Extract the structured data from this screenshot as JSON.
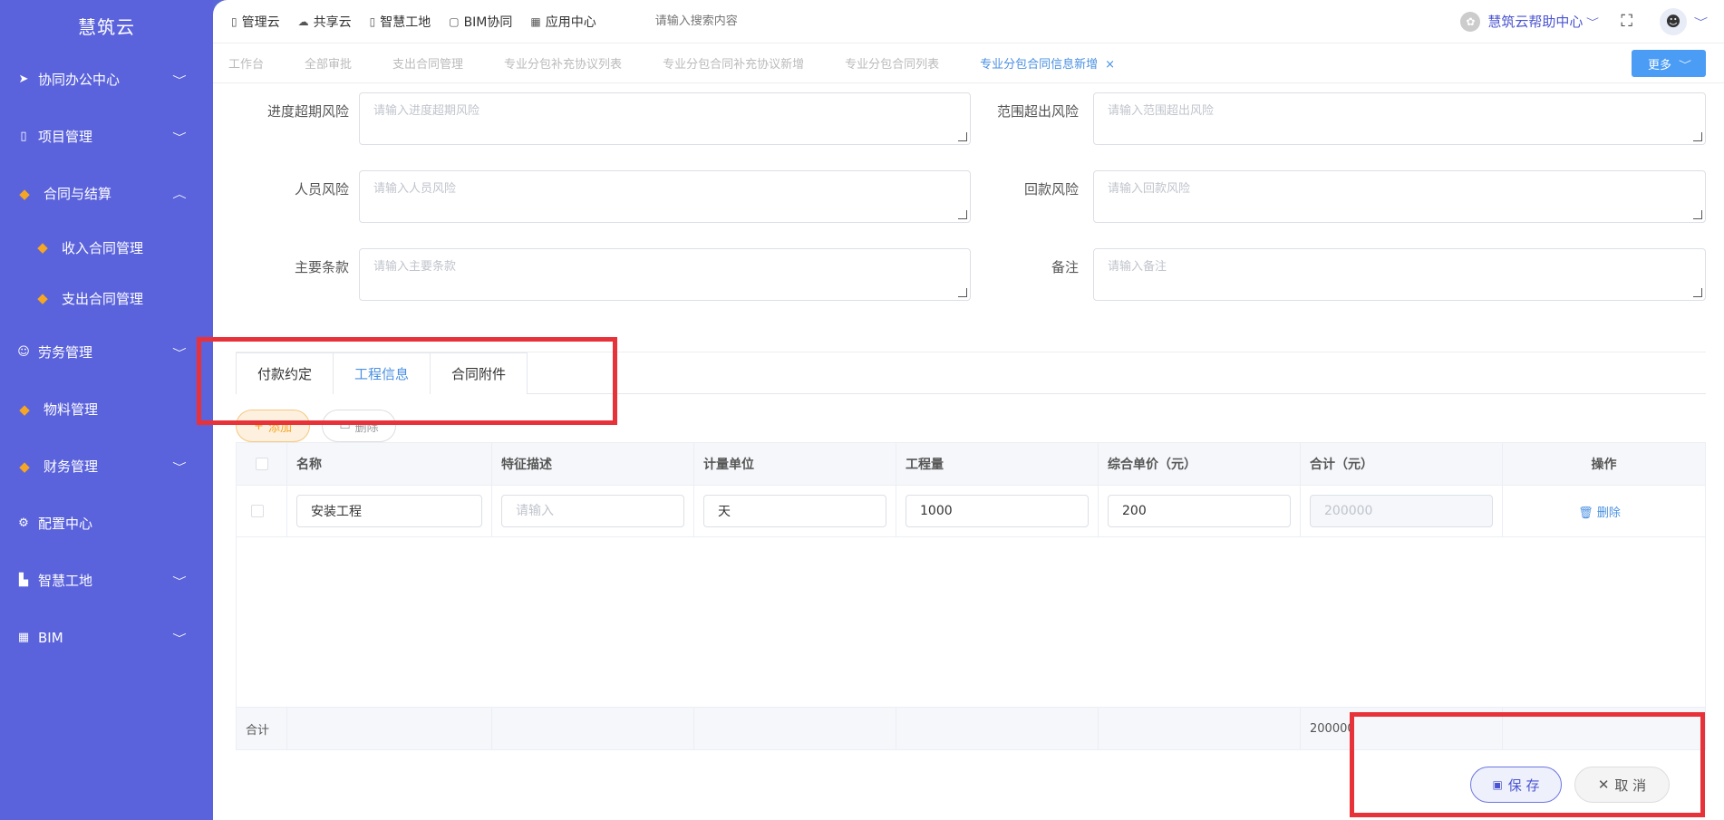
{
  "sidebar": {
    "brand": "慧筑云",
    "items": [
      {
        "label": "协同办公中心",
        "chevron": "﹀"
      },
      {
        "label": "项目管理",
        "chevron": "﹀"
      },
      {
        "label": "合同与结算",
        "chevron": "︿"
      },
      {
        "label": "收入合同管理"
      },
      {
        "label": "支出合同管理"
      },
      {
        "label": "劳务管理",
        "chevron": "﹀"
      },
      {
        "label": "物料管理"
      },
      {
        "label": "财务管理",
        "chevron": "﹀"
      },
      {
        "label": "配置中心"
      },
      {
        "label": "智慧工地",
        "chevron": "﹀"
      },
      {
        "label": "BIM",
        "chevron": "﹀"
      }
    ]
  },
  "topbar": {
    "links": [
      "管理云",
      "共享云",
      "智慧工地",
      "BIM协同",
      "应用中心"
    ],
    "search_placeholder": "请输入搜索内容",
    "help": "慧筑云帮助中心"
  },
  "tabs": {
    "items": [
      "工作台",
      "全部审批",
      "支出合同管理",
      "专业分包补充协议列表",
      "专业分包合同补充协议新增",
      "专业分包合同列表",
      "专业分包合同信息新增"
    ],
    "close": "×",
    "more": "更多"
  },
  "form": {
    "rows": [
      {
        "left_label": "进度超期风险",
        "left_ph": "请输入进度超期风险",
        "right_label": "范围超出风险",
        "right_ph": "请输入范围超出风险"
      },
      {
        "left_label": "人员风险",
        "left_ph": "请输入人员风险",
        "right_label": "回款风险",
        "right_ph": "请输入回款风险"
      },
      {
        "left_label": "主要条款",
        "left_ph": "请输入主要条款",
        "right_label": "备注",
        "right_ph": "请输入备注"
      }
    ]
  },
  "subtabs": [
    "付款约定",
    "工程信息",
    "合同附件"
  ],
  "actions": {
    "add": "添加",
    "delete": "删除"
  },
  "table": {
    "headers": [
      "名称",
      "特征描述",
      "计量单位",
      "工程量",
      "综合单价（元）",
      "合计（元）",
      "操作"
    ],
    "row": {
      "name": "安装工程",
      "desc_ph": "请输入",
      "unit": "天",
      "qty": "1000",
      "price": "200",
      "total": "200000",
      "op": "删除"
    },
    "sum_label": "合计",
    "sum_total": "200000"
  },
  "footer": {
    "save": "保 存",
    "cancel": "取 消"
  },
  "colors": {
    "sidebar": "#5b63dc",
    "primary": "#4a90e2",
    "highlight": "#e8323a",
    "warning": "#f5a623"
  }
}
